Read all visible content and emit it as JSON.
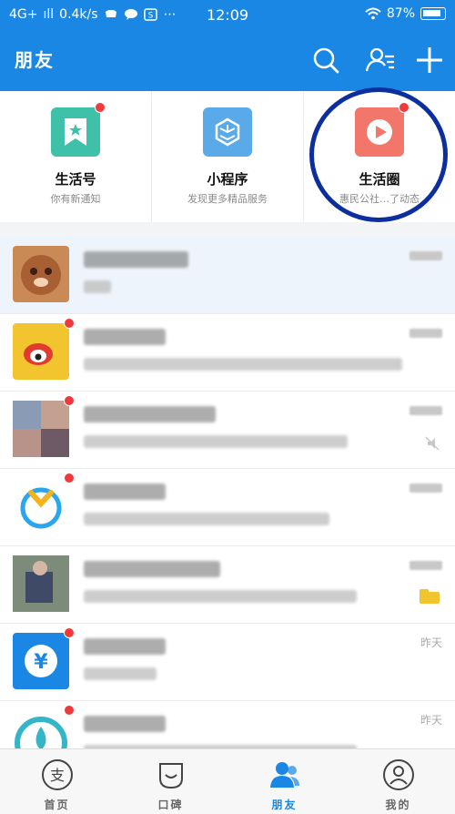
{
  "status_bar": {
    "network": "4G+",
    "signal": "ıll",
    "speed": "0.4k/s",
    "time": "12:09",
    "battery": "87%"
  },
  "header": {
    "title": "朋友",
    "icons": [
      "search-icon",
      "contacts-icon",
      "add-icon"
    ]
  },
  "quick_entries": [
    {
      "label": "生活号",
      "sub": "你有新通知",
      "icon": "bookmark-star-icon",
      "color": "#3ec1a8",
      "badge": true
    },
    {
      "label": "小程序",
      "sub": "发现更多精品服务",
      "icon": "mini-program-icon",
      "color": "#5aa9e8",
      "badge": false
    },
    {
      "label": "生活圈",
      "sub": "惠民公社…了动态",
      "icon": "life-circle-icon",
      "color": "#f2776a",
      "badge": true
    }
  ],
  "list": {
    "items": [
      {
        "avatar": "#c98a55",
        "badge": false,
        "pinned": true,
        "title_w": 115,
        "sub_w": 30,
        "time": ""
      },
      {
        "avatar": "#f2c42d",
        "badge": true,
        "pinned": false,
        "title_w": 90,
        "sub_w": 350,
        "time": ""
      },
      {
        "avatar": "#9e7a6a",
        "badge": true,
        "pinned": false,
        "title_w": 145,
        "sub_w": 290,
        "time": ""
      },
      {
        "avatar": "#ffffff",
        "badge": true,
        "pinned": false,
        "title_w": 90,
        "sub_w": 270,
        "time": ""
      },
      {
        "avatar": "#556677",
        "badge": false,
        "pinned": false,
        "title_w": 150,
        "sub_w": 300,
        "time": ""
      },
      {
        "avatar": "#1a87e4",
        "badge": true,
        "pinned": false,
        "title_w": 90,
        "sub_w": 80,
        "time": "昨天"
      },
      {
        "avatar": "#34b6c8",
        "badge": true,
        "pinned": false,
        "title_w": 90,
        "sub_w": 300,
        "time": "昨天"
      }
    ]
  },
  "tab_bar": {
    "tabs": [
      {
        "label": "首页",
        "icon": "alipay-icon",
        "active": false
      },
      {
        "label": "口碑",
        "icon": "koubei-icon",
        "active": false
      },
      {
        "label": "朋友",
        "icon": "friends-icon",
        "active": true
      },
      {
        "label": "我的",
        "icon": "profile-icon",
        "active": false
      }
    ]
  },
  "colors": {
    "brand_blue": "#1a87e4",
    "badge_red": "#f0393a",
    "highlight_ring": "#0c2f9d"
  }
}
